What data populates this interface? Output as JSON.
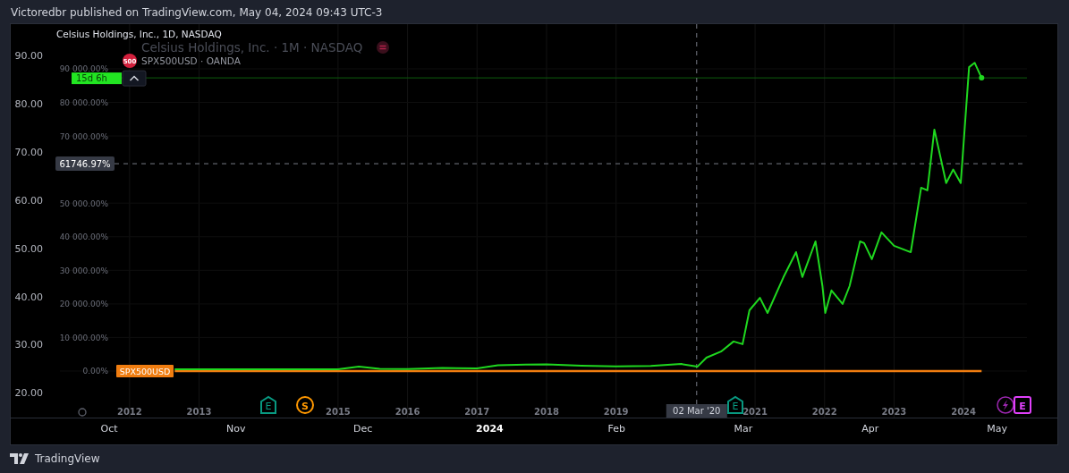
{
  "header": {
    "text": "Victoredbr published on TradingView.com, May 04, 2024 09:43 UTC-3"
  },
  "legend": {
    "title": "Celsius Holdings, Inc., 1D, NASDAQ",
    "overlay_title": "Celsius Holdings, Inc. · 1M · NASDAQ",
    "compare_symbol": {
      "badge": "500",
      "label": "SPX500USD · OANDA"
    }
  },
  "price_scale": {
    "labels": [
      "90.00",
      "80.00",
      "70.00",
      "60.00",
      "50.00",
      "40.00",
      "30.00",
      "20.00"
    ]
  },
  "time_scale": {
    "labels": [
      {
        "text": "Oct",
        "bold": false
      },
      {
        "text": "Nov",
        "bold": false
      },
      {
        "text": "Dec",
        "bold": false
      },
      {
        "text": "2024",
        "bold": true
      },
      {
        "text": "Feb",
        "bold": false
      },
      {
        "text": "Mar",
        "bold": false
      },
      {
        "text": "Apr",
        "bold": false
      },
      {
        "text": "May",
        "bold": false
      }
    ]
  },
  "events": [
    {
      "kind": "earnings",
      "label": "E",
      "color": "#089981"
    },
    {
      "kind": "dividend",
      "label": "S",
      "color": "#ff9800"
    },
    {
      "kind": "earnings",
      "label": "E",
      "color": "#089981"
    },
    {
      "kind": "news",
      "color": "#9c27b0"
    },
    {
      "kind": "earnings_upcoming",
      "label": "E",
      "color": "#e040fb"
    }
  ],
  "chart_data": {
    "type": "line",
    "grid": true,
    "x": [
      2012.65,
      2013,
      2014,
      2015,
      2015.3,
      2015.6,
      2016,
      2016.5,
      2017,
      2017.3,
      2017.7,
      2018,
      2018.5,
      2019,
      2019.5,
      2019.94,
      2020.17,
      2020.3,
      2020.51,
      2020.69,
      2020.82,
      2020.92,
      2021.07,
      2021.18,
      2021.41,
      2021.59,
      2021.68,
      2021.87,
      2021.97,
      2022.01,
      2022.1,
      2022.26,
      2022.36,
      2022.51,
      2022.57,
      2022.68,
      2022.82,
      2023.0,
      2023.24,
      2023.39,
      2023.48,
      2023.58,
      2023.75,
      2023.85,
      2023.96,
      2024.08,
      2024.16,
      2024.26
    ],
    "series": [
      {
        "color": "#1fd81f",
        "values": [
          500,
          500,
          500,
          500,
          1300,
          700,
          600,
          900,
          800,
          1700,
          1900,
          2000,
          1600,
          1400,
          1500,
          2100,
          1300,
          4000,
          5800,
          8800,
          8000,
          18100,
          21800,
          17300,
          28000,
          35400,
          28000,
          38600,
          25300,
          17300,
          24000,
          20000,
          25300,
          38600,
          38100,
          33300,
          41300,
          37300,
          35400,
          54600,
          53800,
          71900,
          56000,
          60000,
          56000,
          90500,
          91800,
          87300
        ]
      },
      {
        "name": "SPX500USD",
        "color": "#f07d10",
        "values": [
          0,
          0,
          0,
          0,
          0,
          0,
          0,
          0,
          0,
          0,
          0,
          0,
          0,
          0,
          0,
          0,
          0,
          0,
          0,
          0,
          0,
          0,
          0,
          0,
          0,
          0,
          0,
          0,
          0,
          0,
          0,
          0,
          0,
          0,
          0,
          0,
          0,
          0,
          0,
          0,
          0,
          0,
          0,
          0,
          0,
          0,
          0,
          0
        ]
      }
    ],
    "xlim": [
      2010.29,
      2025.35
    ],
    "ylim": [
      -13850,
      103300
    ],
    "xticks": [
      {
        "value": 2012,
        "label": "2012"
      },
      {
        "value": 2013,
        "label": "2013"
      },
      {
        "value": 2015,
        "label": "2015"
      },
      {
        "value": 2016,
        "label": "2016"
      },
      {
        "value": 2017,
        "label": "2017"
      },
      {
        "value": 2018,
        "label": "2018"
      },
      {
        "value": 2019,
        "label": "2019"
      },
      {
        "value": 2021,
        "label": "2021"
      },
      {
        "value": 2022,
        "label": "2022"
      },
      {
        "value": 2023,
        "label": "2023"
      },
      {
        "value": 2024,
        "label": "2024"
      }
    ],
    "yticks": [
      {
        "value": 0,
        "label": "0.00%"
      },
      {
        "value": 10000,
        "label": "10 000.00%"
      },
      {
        "value": 20000,
        "label": "20 000.00%"
      },
      {
        "value": 30000,
        "label": "30 000.00%"
      },
      {
        "value": 40000,
        "label": "40 000.00%"
      },
      {
        "value": 50000,
        "label": "50 000.00%"
      },
      {
        "value": 70000,
        "label": "70 000.00%"
      },
      {
        "value": 80000,
        "label": "80 000.00%"
      },
      {
        "value": 90000,
        "label": "90 000.00%"
      }
    ],
    "ref_lines": [
      {
        "axis": "y",
        "value": 87300,
        "color": "#0d5c0d"
      },
      {
        "axis": "x",
        "value": 2020.16,
        "label": "02 Mar '20"
      },
      {
        "axis": "y",
        "value": 61746.97,
        "label": "61746.97%"
      }
    ]
  },
  "countdown": {
    "label": "15d 6h",
    "color": "#22e522"
  },
  "footer": {
    "brand": "TradingView"
  }
}
